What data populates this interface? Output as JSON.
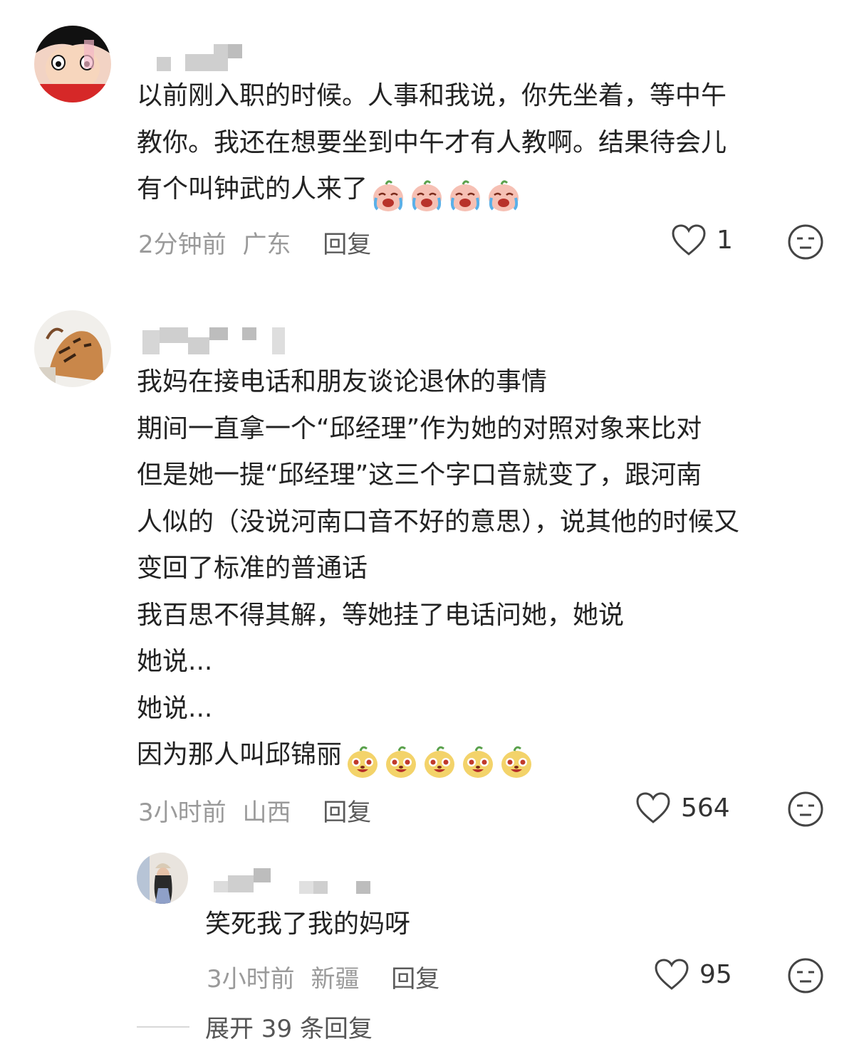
{
  "comments": [
    {
      "lines": [
        "以前刚入职的时候。人事和我说，你先坐着，等中午",
        "教你。我还在想要坐到中午才有人教啊。结果待会儿",
        "有个叫钟武的人来了"
      ],
      "emoji_name": "crying-face",
      "emoji_count": 4,
      "time": "2分钟前",
      "location": "广东",
      "reply_label": "回复",
      "likes": "1"
    },
    {
      "lines": [
        "我妈在接电话和朋友谈论退休的事情",
        "期间一直拿一个“邱经理”作为她的对照对象来比对",
        "但是她一提“邱经理”这三个字口音就变了，跟河南",
        "人似的（没说河南口音不好的意思），说其他的时候又",
        "变回了标准的普通话",
        "我百思不得其解，等她挂了电话问她，她说",
        "她说...",
        "她说...",
        "因为那人叫邱锦丽"
      ],
      "emoji_name": "laughing-face",
      "emoji_count": 5,
      "time": "3小时前",
      "location": "山西",
      "reply_label": "回复",
      "likes": "564"
    }
  ],
  "reply": {
    "text": "笑死我了我的妈呀",
    "time": "3小时前",
    "location": "新疆",
    "reply_label": "回复",
    "likes": "95"
  },
  "expand_label": "展开 39 条回复",
  "icons": {
    "like": "heart-outline-icon",
    "dislike": "unamused-face-icon"
  },
  "colors": {
    "text": "#222222",
    "meta": "#9a9a9a",
    "reply": "#5a5a5a"
  }
}
